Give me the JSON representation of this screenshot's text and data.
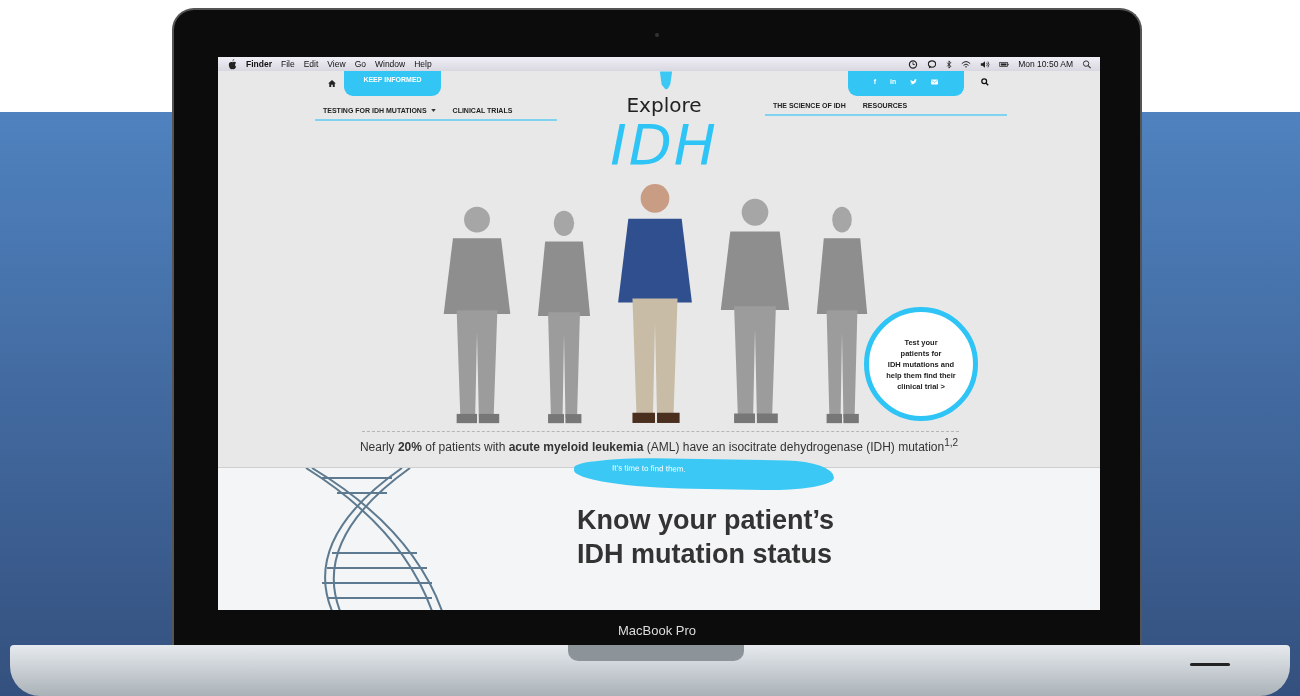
{
  "menubar": {
    "app": "Finder",
    "menus": [
      "File",
      "Edit",
      "View",
      "Go",
      "Window",
      "Help"
    ],
    "clock": "Mon 10:50 AM"
  },
  "header": {
    "keep_informed": "KEEP INFORMED",
    "nav_left": [
      {
        "label": "TESTING FOR IDH MUTATIONS",
        "dropdown": true
      },
      {
        "label": "CLINICAL TRIALS",
        "dropdown": false
      }
    ],
    "logo": {
      "line1": "Explore",
      "line2": "IDH"
    },
    "social": [
      {
        "kind": "text",
        "label": "f"
      },
      {
        "kind": "text",
        "label": "in"
      },
      {
        "kind": "twitter"
      },
      {
        "kind": "mail"
      }
    ],
    "nav_right": [
      "THE SCIENCE OF IDH",
      "RESOURCES"
    ]
  },
  "hero": {
    "people": [
      {
        "highlighted": false
      },
      {
        "highlighted": false
      },
      {
        "highlighted": true
      },
      {
        "highlighted": false
      },
      {
        "highlighted": false
      }
    ],
    "cta_lines": [
      "Test your",
      "patients for",
      "IDH mutations and",
      "help them find their",
      "clinical trial >"
    ],
    "caption": "Nearly **20%** of patients with **acute myeloid leukemia** (AML) have an isocitrate dehydrogenase (IDH) mutation$^{1,2}$"
  },
  "section": {
    "tagline": "It’s time to find them.",
    "heading_lines": [
      "Know your patient’s",
      "IDH mutation status"
    ]
  },
  "laptop_label": "MacBook Pro"
}
